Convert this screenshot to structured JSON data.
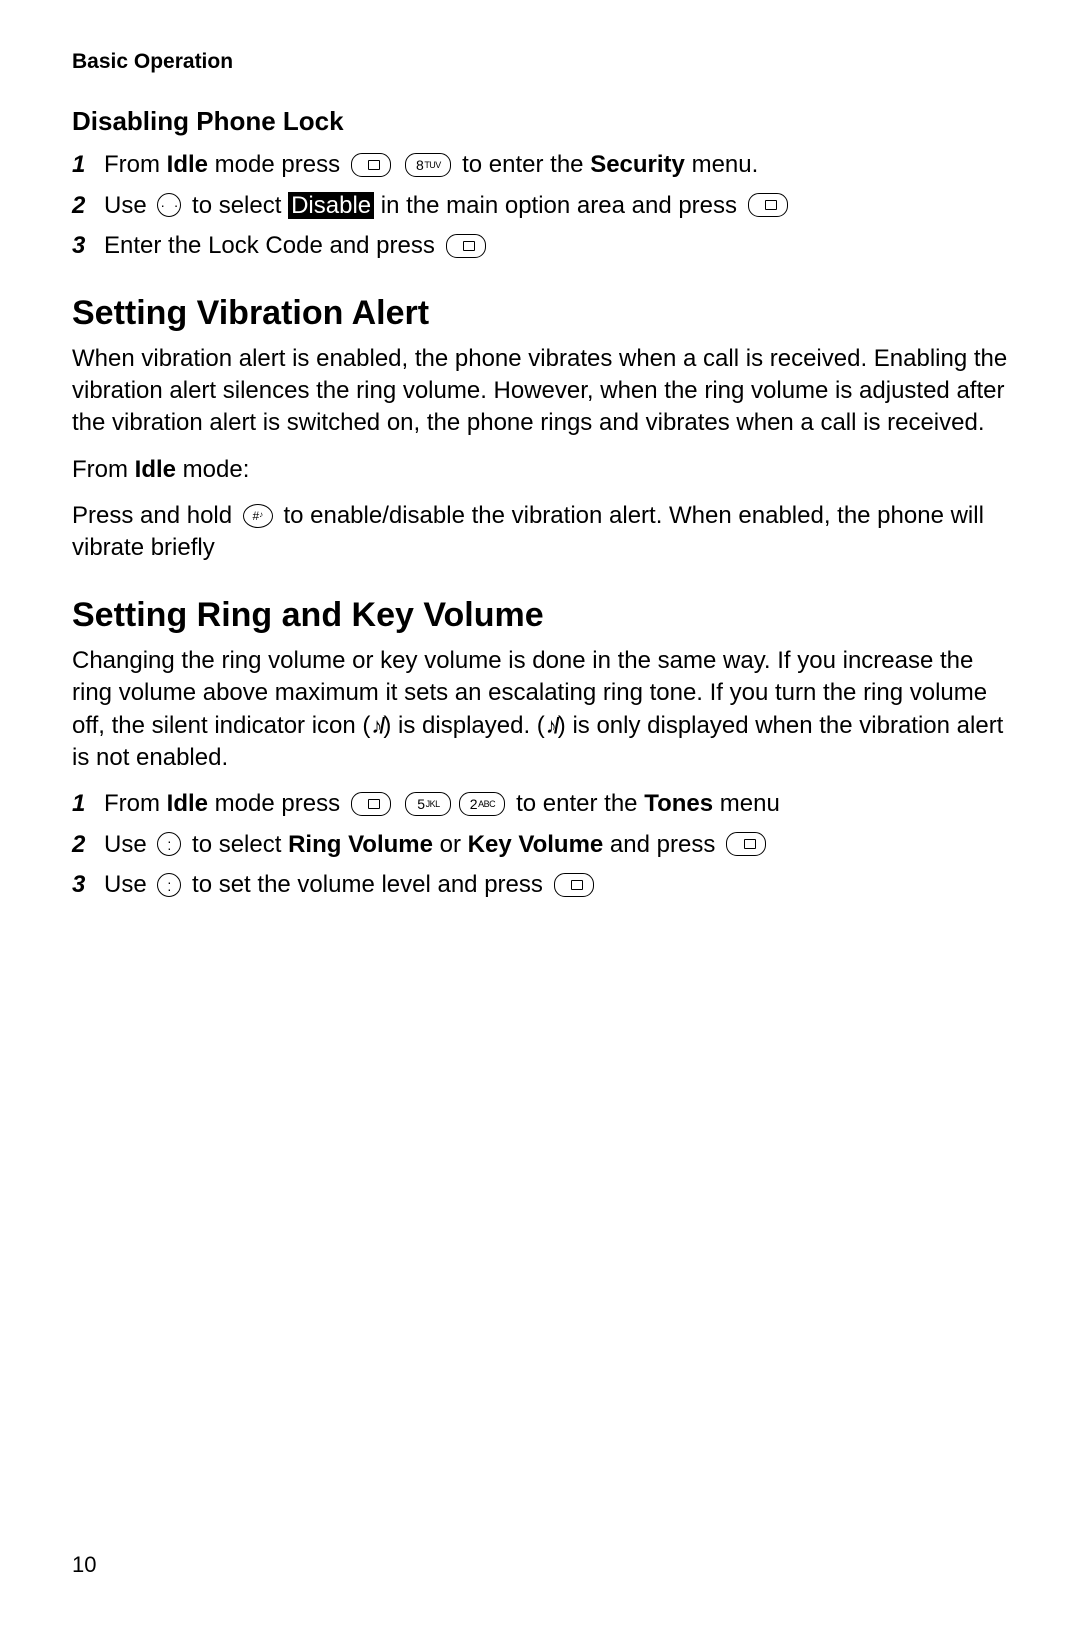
{
  "running_head": "Basic Operation",
  "page_number": "10",
  "disable_lock": {
    "heading": "Disabling Phone Lock",
    "step1": {
      "pre": "From ",
      "idle": "Idle",
      "mid": " mode press ",
      "post": " to enter the ",
      "sec": "Security",
      "end": " menu."
    },
    "step2": {
      "pre": "Use ",
      "mid": " to select ",
      "disable": "Disable",
      "mid2": " in the main option area and press "
    },
    "step3": {
      "pre": "Enter the Lock Code and press "
    }
  },
  "vibration": {
    "heading": "Setting Vibration Alert",
    "para": "When vibration alert is enabled, the phone vibrates when a call is received. Enabling the vibration alert silences the ring volume. However, when the ring volume is adjusted after the vibration alert is switched on, the phone rings and vibrates when a call is received.",
    "from_pre": "From ",
    "from_idle": "Idle",
    "from_post": " mode:",
    "instr_pre": "Press and hold ",
    "instr_post": " to enable/disable the vibration alert. When enabled, the phone will vibrate briefly"
  },
  "ringkey": {
    "heading": "Setting Ring and Key Volume",
    "para_a": "Changing the ring volume or key volume is done in the same way. If you increase the ring volume above maximum it sets an escalating ring tone. If you turn the ring volume off, the silent indicator icon (",
    "para_b": ") is displayed. (",
    "para_c": ") is only displayed when the vibration alert is not enabled.",
    "step1": {
      "pre": "From ",
      "idle": "Idle",
      "mid": " mode press ",
      "post": " to enter the ",
      "tones": "Tones",
      "end": " menu"
    },
    "step2": {
      "pre": "Use ",
      "mid": " to select ",
      "rv": "Ring Volume",
      "or": " or ",
      "kv": "Key Volume",
      "post": " and press "
    },
    "step3": {
      "pre": "Use ",
      "mid": " to set the volume level and press "
    }
  },
  "keylabels": {
    "k8": {
      "n": "8",
      "t": "TUV"
    },
    "k5": {
      "n": "5",
      "t": "JKL"
    },
    "k2": {
      "n": "2",
      "t": "ABC"
    },
    "hash": {
      "n": "#"
    }
  }
}
